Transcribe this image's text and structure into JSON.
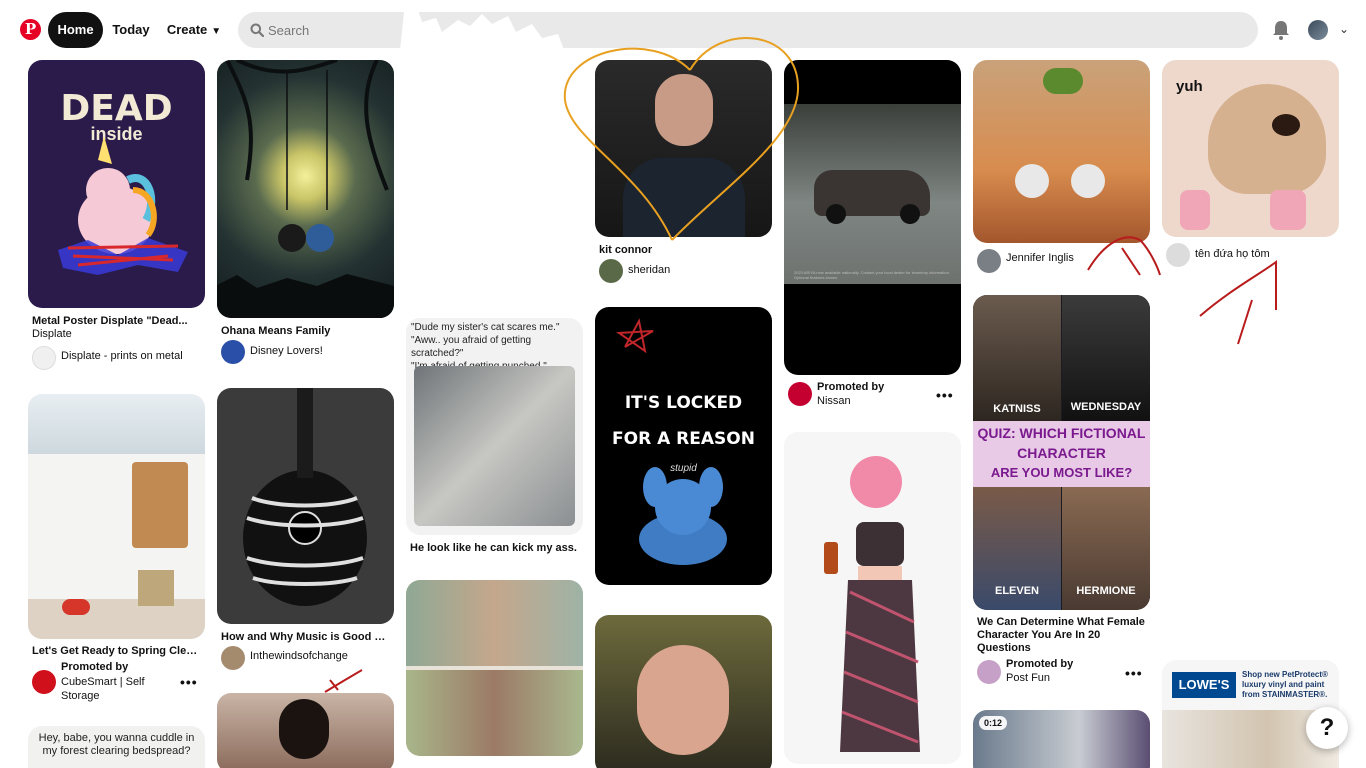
{
  "header": {
    "logo_letter": "P",
    "nav": {
      "home": "Home",
      "today": "Today",
      "create": "Create"
    },
    "search_placeholder": "Search"
  },
  "pins": {
    "dead_inside": {
      "img_title": "DEAD",
      "img_sub": "inside",
      "title": "Metal Poster Displate \"Dead...",
      "brand": "Displate",
      "user": "Displate - prints on metal"
    },
    "ohana": {
      "title": "Ohana Means Family",
      "user": "Disney Lovers!"
    },
    "cat": {
      "quote": "\"Dude my sister's cat scares me.\"\n\"Aww.. you afraid of getting scratched?\"\n\"I'm afraid of getting punched.\"",
      "title": "He look like he can kick my ass."
    },
    "kit": {
      "title": "kit connor",
      "user": "sheridan"
    },
    "nissan": {
      "promoted": "Promoted by",
      "brand": "Nissan",
      "fineprint": "2023 ARIYA now available nationally. Contact your local dealer for inventory information. Optional features shown."
    },
    "rapunzel": {
      "user": "Jennifer Inglis"
    },
    "dog": {
      "img_text": "yuh",
      "user": "tên đứa họ tôm"
    },
    "kitchen": {
      "title": "Let's Get Ready to Spring Clean!",
      "promoted": "Promoted by",
      "brand": "CubeSmart | Self Storage"
    },
    "guitar": {
      "title": "How and Why Music is Good Fo...",
      "user": "Inthewindsofchange"
    },
    "stitch": {
      "line1": "IT'S LOCKED",
      "line2": "FOR A REASON",
      "line3": "stupid"
    },
    "quiz": {
      "katniss": "KATNISS",
      "wednesday": "WEDNESDAY",
      "q1": "QUIZ: WHICH FICTIONAL",
      "q2": "CHARACTER",
      "q3": "ARE YOU MOST LIKE?",
      "eleven": "ELEVEN",
      "hermione": "HERMIONE",
      "title": "We Can Determine What Female Character You Are In 20 Questions",
      "promoted": "Promoted by",
      "brand": "Post Fun"
    },
    "bedspread": {
      "text": "Hey, babe, you wanna cuddle in my forest clearing bedspread?"
    },
    "video": {
      "duration": "0:12"
    },
    "lowes": {
      "logo": "LOWE'S",
      "ad": "Shop new PetProtect® luxury vinyl and paint from STAINMASTER®."
    }
  },
  "help_label": "?",
  "colors": {
    "brand": "#e60023",
    "scribble_orange": "#e8a020",
    "scribble_red": "#b81c1c"
  }
}
